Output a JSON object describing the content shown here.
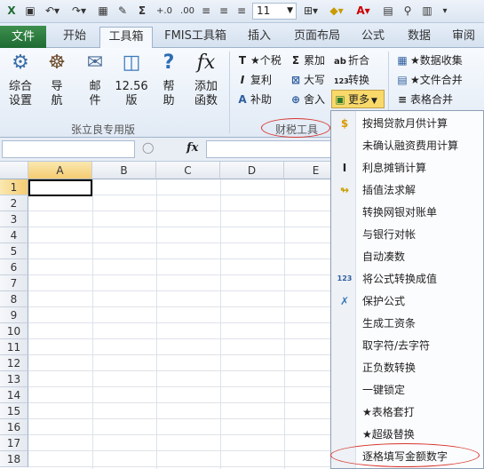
{
  "quick_access": {
    "font_size": "11"
  },
  "tabs": [
    "文件",
    "开始",
    "工具箱",
    "FMIS工具箱",
    "插入",
    "页面布局",
    "公式",
    "数据",
    "审阅"
  ],
  "group1": {
    "label": "张立良专用版",
    "buttons": [
      {
        "line1": "综合",
        "line2": "设置",
        "icon": "settings-gear-icon"
      },
      {
        "line1": "导",
        "line2": "航",
        "icon": "ship-wheel-icon"
      },
      {
        "line1": "邮",
        "line2": "件",
        "icon": "mail-icon"
      },
      {
        "line1": "12.56",
        "line2": "版",
        "icon": "chart-window-icon"
      },
      {
        "line1": "帮",
        "line2": "助",
        "icon": "question-icon"
      },
      {
        "line1": "添加",
        "line2": "函数",
        "icon": "function-fx-icon"
      }
    ]
  },
  "group2": {
    "label": "财税工具",
    "col1": [
      "★个税",
      "复利",
      "补助"
    ],
    "col2": [
      "累加",
      "大写",
      "舍入"
    ],
    "col3": [
      "折合",
      "转换",
      "更多"
    ]
  },
  "group3": {
    "items": [
      "★数据收集",
      "★文件合并",
      "表格合并"
    ]
  },
  "formula_bar": {
    "fx": "fx"
  },
  "columns": [
    "A",
    "B",
    "C",
    "D",
    "E"
  ],
  "rows": [
    "1",
    "2",
    "3",
    "4",
    "5",
    "6",
    "7",
    "8",
    "9",
    "10",
    "11",
    "12",
    "13",
    "14",
    "15",
    "16",
    "17",
    "18"
  ],
  "menu": [
    "按揭贷款月供计算",
    "未确认融资费用计算",
    "利息摊销计算",
    "插值法求解",
    "转换网银对账单",
    "与银行对帐",
    "自动凑数",
    "将公式转换成值",
    "保护公式",
    "生成工资条",
    "取字符/去字符",
    "正负数转换",
    "一键锁定",
    "★表格套打",
    "★超级替换",
    "逐格填写金额数字"
  ],
  "menu_icons": [
    "dollar-icon",
    "",
    "italic-i-icon",
    "function-arrow-icon",
    "",
    "",
    "",
    "abc-123-icon",
    "protect-sheet-icon",
    "",
    "",
    "",
    "",
    "",
    "",
    ""
  ],
  "colors": {
    "file_tab": "#1e6b33",
    "highlight_oval": "#d9332b",
    "more_button": "#f8d96a"
  }
}
